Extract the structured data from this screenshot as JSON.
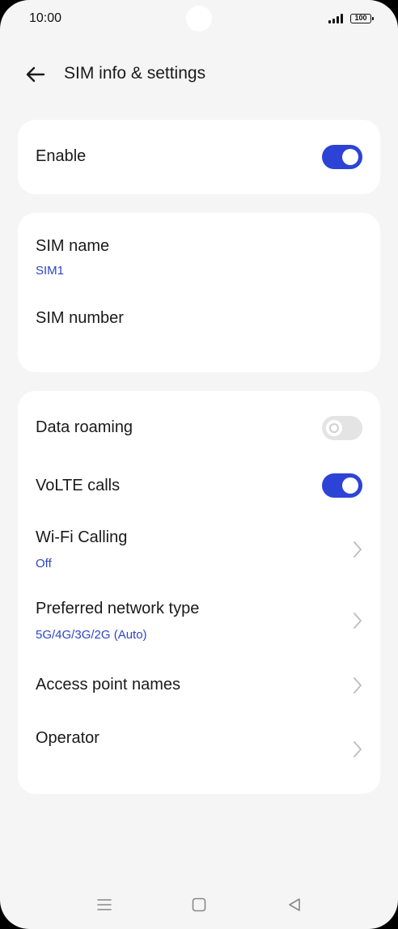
{
  "status_bar": {
    "time": "10:00",
    "battery": "100"
  },
  "header": {
    "title": "SIM info & settings"
  },
  "enable_card": {
    "label": "Enable",
    "enabled": true
  },
  "sim_card": {
    "name_label": "SIM name",
    "name_value": "SIM1",
    "number_label": "SIM number"
  },
  "settings_card": {
    "data_roaming": {
      "label": "Data roaming",
      "enabled": false
    },
    "volte": {
      "label": "VoLTE calls",
      "enabled": true
    },
    "wifi_calling": {
      "label": "Wi-Fi Calling",
      "value": "Off"
    },
    "network_type": {
      "label": "Preferred network type",
      "value": "5G/4G/3G/2G (Auto)"
    },
    "apn": {
      "label": "Access point names"
    },
    "operator": {
      "label": "Operator"
    }
  },
  "colors": {
    "accent": "#2d43d6",
    "subtext": "#2e45c8",
    "background": "#f5f5f5"
  },
  "icons": [
    "back-arrow-icon",
    "chevron-right-icon",
    "menu-icon",
    "home-icon",
    "back-triangle-icon"
  ]
}
